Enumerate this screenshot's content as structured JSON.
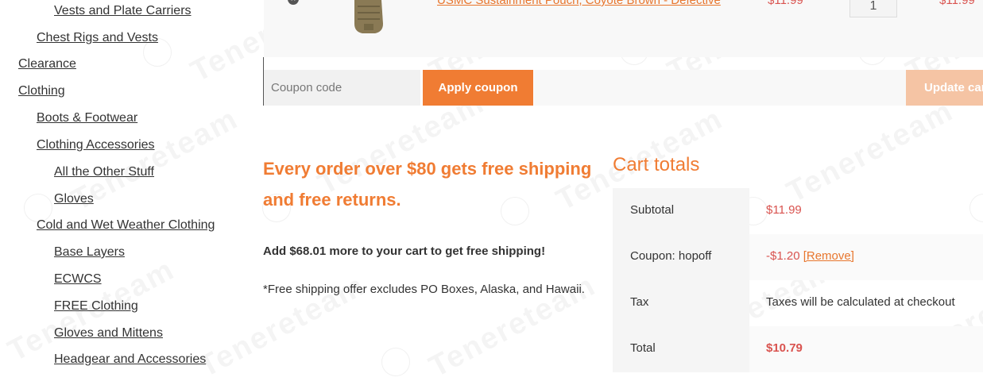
{
  "sidebar": {
    "categories": [
      {
        "label": "Vests and Plate Carriers",
        "level": 2
      },
      {
        "label": "Chest Rigs and Vests",
        "level": 1
      },
      {
        "label": "Clearance",
        "level": 0
      },
      {
        "label": "Clothing",
        "level": 0
      },
      {
        "label": "Boots & Footwear",
        "level": 1
      },
      {
        "label": "Clothing Accessories",
        "level": 1
      },
      {
        "label": "All the Other Stuff",
        "level": 2
      },
      {
        "label": "Gloves",
        "level": 2
      },
      {
        "label": "Cold and Wet Weather Clothing",
        "level": 1
      },
      {
        "label": "Base Layers",
        "level": 2
      },
      {
        "label": "ECWCS",
        "level": 2
      },
      {
        "label": "FREE Clothing",
        "level": 2
      },
      {
        "label": "Gloves and Mittens",
        "level": 2
      },
      {
        "label": "Headgear and Accessories",
        "level": 2
      }
    ]
  },
  "cart_item": {
    "remove_symbol": "×",
    "name": "USMC Sustainment Pouch, Coyote Brown - Defective",
    "price": "$11.99",
    "quantity": "1",
    "subtotal": "$11.99"
  },
  "coupon": {
    "placeholder": "Coupon code",
    "apply_label": "Apply coupon",
    "update_label": "Update cart"
  },
  "promo": {
    "heading": "Every order over $80 gets free shipping and free returns.",
    "add_more": "Add $68.01 more to your cart to get free shipping!",
    "note": "*Free shipping offer excludes PO Boxes, Alaska, and Hawaii."
  },
  "totals": {
    "title": "Cart totals",
    "subtotal_label": "Subtotal",
    "subtotal_value": "$11.99",
    "coupon_label": "Coupon: hopoff",
    "coupon_value": "-$1.20",
    "coupon_remove": "[Remove]",
    "tax_label": "Tax",
    "tax_value": "Taxes will be calculated at checkout",
    "total_label": "Total",
    "total_value": "$10.79"
  },
  "watermark": {
    "text": "Tenereteam"
  },
  "colors": {
    "accent": "#f07c33",
    "price": "#d9534f",
    "update_disabled": "#f5c4a4"
  }
}
